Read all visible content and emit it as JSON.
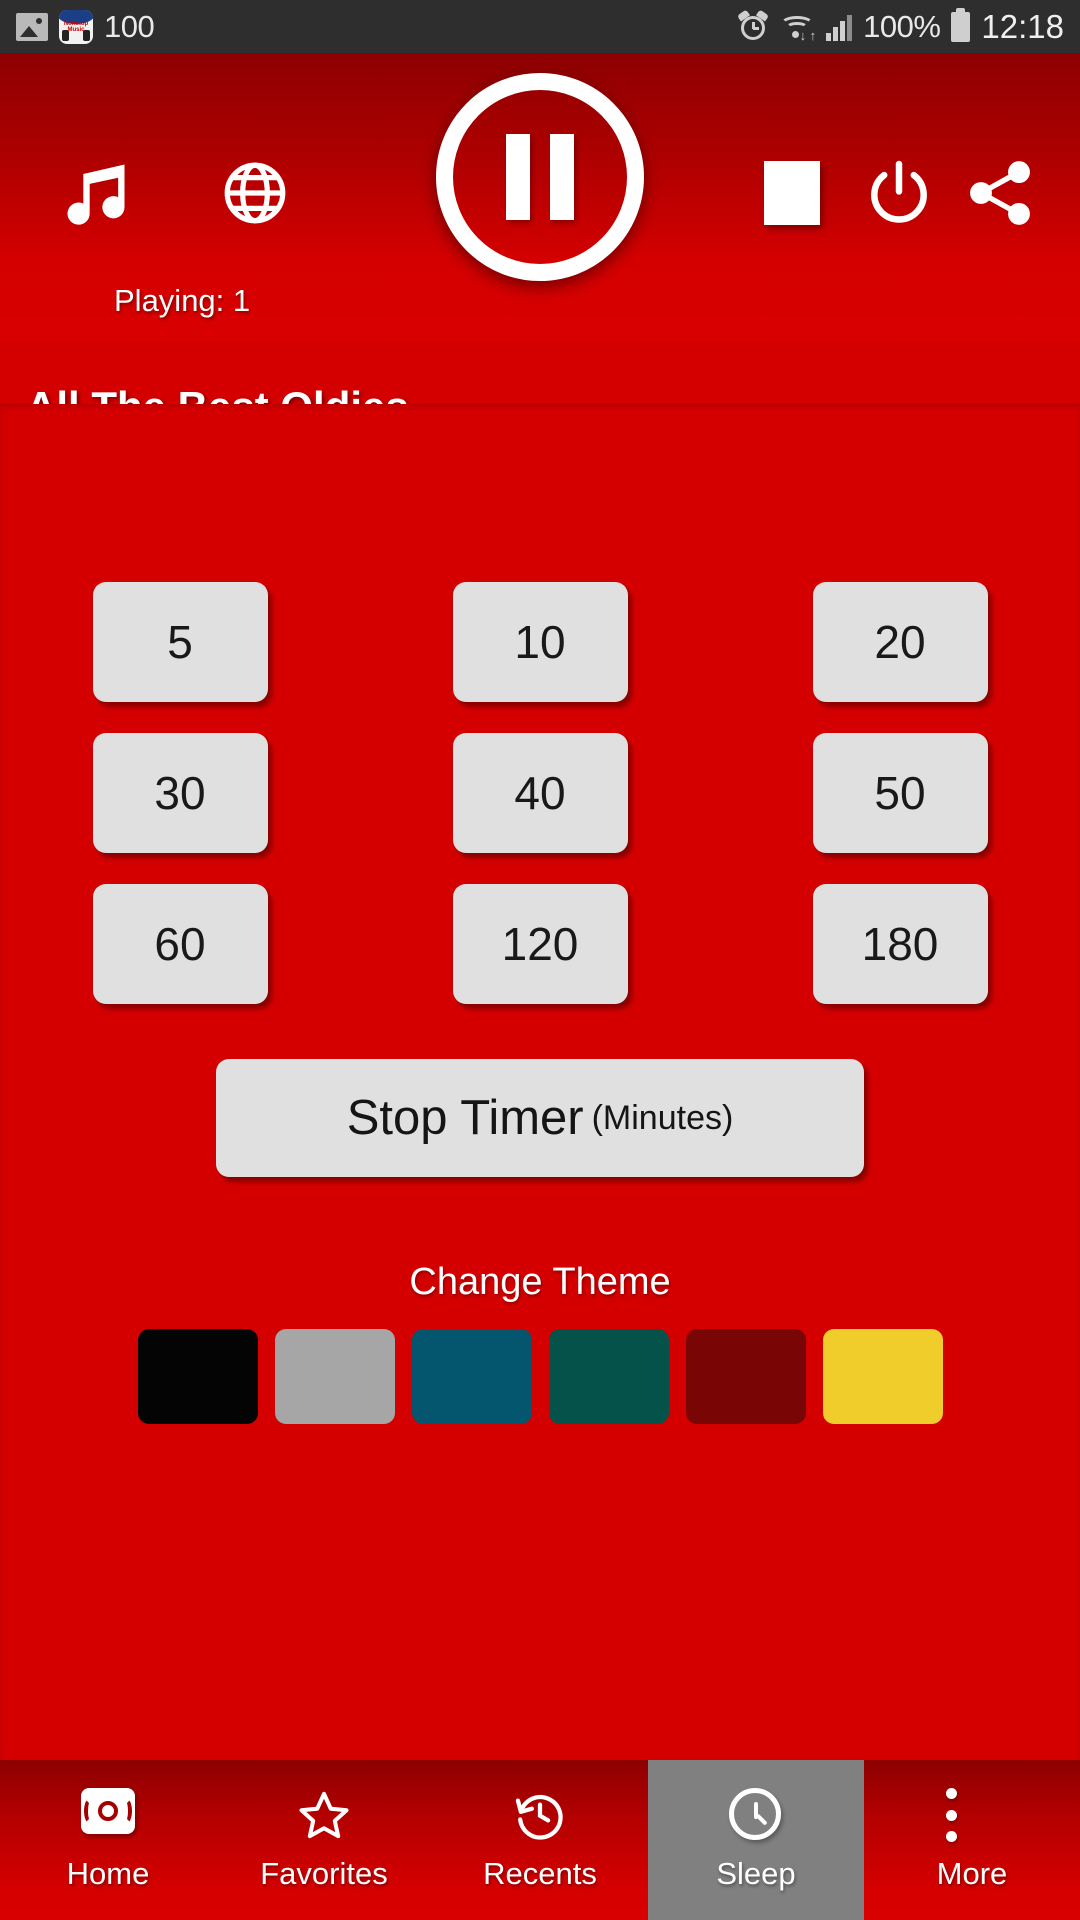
{
  "status_bar": {
    "time": "12:18",
    "battery_percent": "100%",
    "notification_count": "100",
    "app_icon_text": "Nonstop Music",
    "icons": [
      "image-icon",
      "app-notification-icon",
      "alarm-icon",
      "wifi-icon",
      "signal-icon",
      "battery-icon"
    ]
  },
  "header": {
    "playing_label": "Playing: 1",
    "station_title": "All The Best Oldies",
    "music_icon": "music-note-icon",
    "globe_icon": "globe-icon",
    "play_pause_icon": "pause-icon",
    "stop_icon": "stop-icon",
    "power_icon": "power-icon",
    "share_icon": "share-icon"
  },
  "sleep_timer": {
    "options": [
      "5",
      "10",
      "20",
      "30",
      "40",
      "50",
      "60",
      "120",
      "180"
    ],
    "stop_button_main": "Stop Timer",
    "stop_button_unit": "(Minutes)"
  },
  "theme": {
    "label": "Change Theme",
    "swatches": [
      {
        "name": "black",
        "color": "#040404"
      },
      {
        "name": "gray",
        "color": "#a6a6a6"
      },
      {
        "name": "teal-blue",
        "color": "#04566e"
      },
      {
        "name": "dark-green",
        "color": "#04524a"
      },
      {
        "name": "dark-red",
        "color": "#7a0505"
      },
      {
        "name": "yellow",
        "color": "#f0cd2b"
      }
    ]
  },
  "bottom_nav": {
    "items": [
      {
        "label": "Home",
        "icon": "radio-icon",
        "active": false
      },
      {
        "label": "Favorites",
        "icon": "star-icon",
        "active": false
      },
      {
        "label": "Recents",
        "icon": "history-icon",
        "active": false
      },
      {
        "label": "Sleep",
        "icon": "clock-icon",
        "active": true
      },
      {
        "label": "More",
        "icon": "more-vertical-icon",
        "active": false
      }
    ]
  },
  "colors": {
    "primary_red": "#d40000",
    "header_dark": "#8d0000",
    "button_face": "#e0e0e0",
    "active_nav": "#808080",
    "status_bar": "#2e2e2e"
  }
}
